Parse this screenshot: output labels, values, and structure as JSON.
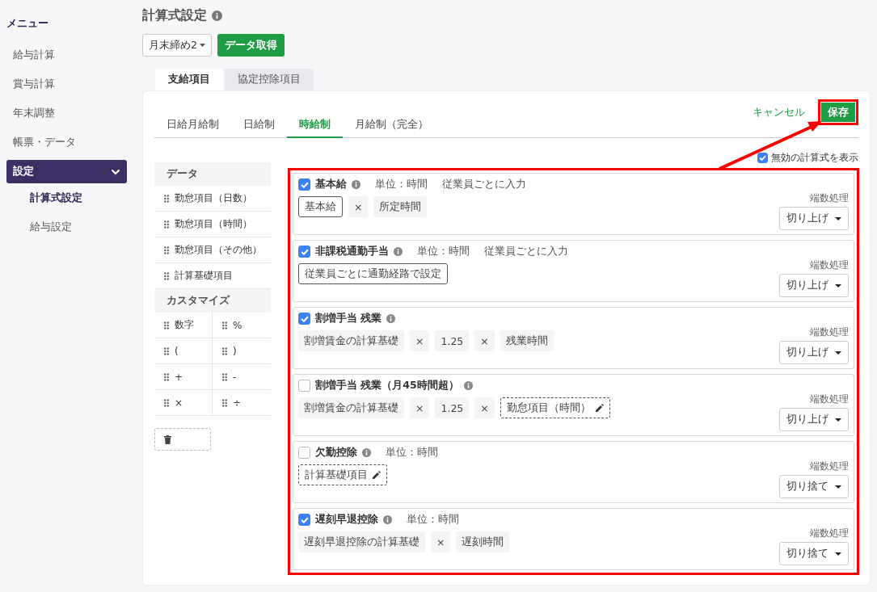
{
  "sidebar": {
    "title": "メニュー",
    "items": [
      {
        "label": "給与計算",
        "selected": false
      },
      {
        "label": "賞与計算",
        "selected": false
      },
      {
        "label": "年末調整",
        "selected": false
      },
      {
        "label": "帳票・データ",
        "selected": false
      },
      {
        "label": "設定",
        "selected": true,
        "expanded": true,
        "children": [
          {
            "label": "計算式設定",
            "selected": true
          },
          {
            "label": "給与設定",
            "selected": false
          }
        ]
      }
    ]
  },
  "page": {
    "title": "計算式設定",
    "period_select": "月末締め2",
    "fetch_button": "データ取得"
  },
  "tabs": [
    {
      "label": "支給項目",
      "selected": true
    },
    {
      "label": "協定控除項目",
      "selected": false
    }
  ],
  "subtabs": [
    {
      "label": "日給月給制",
      "selected": false
    },
    {
      "label": "日給制",
      "selected": false
    },
    {
      "label": "時給制",
      "selected": true
    },
    {
      "label": "月給制（完全）",
      "selected": false
    }
  ],
  "actions": {
    "cancel": "キャンセル",
    "save": "保存"
  },
  "show_disabled": {
    "label": "無効の計算式を表示",
    "checked": true
  },
  "palette": {
    "data_heading": "データ",
    "data_items": [
      "勤怠項目（日数）",
      "勤怠項目（時間）",
      "勤怠項目（その他）",
      "計算基礎項目"
    ],
    "custom_heading": "カスタマイズ",
    "custom_items": [
      "数字",
      "%",
      "(",
      ")",
      "+",
      "-",
      "×",
      "÷"
    ]
  },
  "formulas": [
    {
      "name": "基本給",
      "checked": true,
      "meta": [
        "単位：時間",
        "従業員ごとに入力"
      ],
      "tokens": [
        {
          "kind": "fixed",
          "text": "基本給"
        },
        {
          "kind": "chip",
          "text": "×"
        },
        {
          "kind": "chip",
          "text": "所定時間"
        }
      ],
      "rounding_label": "端数処理",
      "rounding": "切り上げ"
    },
    {
      "name": "非課税通勤手当",
      "checked": true,
      "meta": [
        "単位：時間",
        "従業員ごとに入力"
      ],
      "tokens": [
        {
          "kind": "fixed",
          "text": "従業員ごとに通勤経路で設定"
        }
      ],
      "rounding_label": "端数処理",
      "rounding": "切り上げ"
    },
    {
      "name": "割増手当 残業",
      "checked": true,
      "tokens": [
        {
          "kind": "chip",
          "text": "割増賃金の計算基礎"
        },
        {
          "kind": "chip",
          "text": "×"
        },
        {
          "kind": "chip",
          "text": "1.25"
        },
        {
          "kind": "chip",
          "text": "×"
        },
        {
          "kind": "chip",
          "text": "残業時間"
        }
      ],
      "rounding_label": "端数処理",
      "rounding": "切り上げ"
    },
    {
      "name": "割増手当 残業（月45時間超）",
      "checked": false,
      "tokens": [
        {
          "kind": "chip",
          "text": "割増賃金の計算基礎"
        },
        {
          "kind": "chip",
          "text": "×"
        },
        {
          "kind": "chip",
          "text": "1.25"
        },
        {
          "kind": "chip",
          "text": "×"
        },
        {
          "kind": "editable",
          "text": "勤怠項目（時間）"
        }
      ],
      "rounding_label": "端数処理",
      "rounding": "切り上げ"
    },
    {
      "name": "欠勤控除",
      "checked": false,
      "meta": [
        "単位：時間"
      ],
      "tokens": [
        {
          "kind": "editable",
          "text": "計算基礎項目"
        }
      ],
      "rounding_label": "端数処理",
      "rounding": "切り捨て"
    },
    {
      "name": "遅刻早退控除",
      "checked": true,
      "meta": [
        "単位：時間"
      ],
      "tokens": [
        {
          "kind": "chip",
          "text": "遅刻早退控除の計算基礎"
        },
        {
          "kind": "chip",
          "text": "×"
        },
        {
          "kind": "chip",
          "text": "遅刻時間"
        }
      ],
      "rounding_label": "端数処理",
      "rounding": "切り捨て"
    }
  ]
}
